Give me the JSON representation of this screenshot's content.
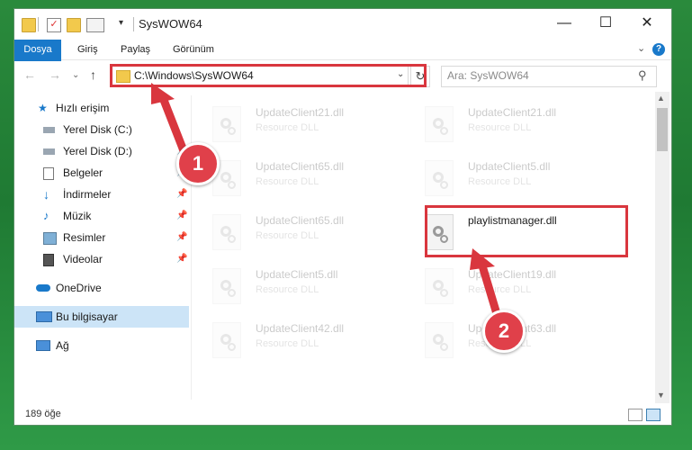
{
  "window": {
    "title": "SysWOW64",
    "controls": {
      "minimize": "—",
      "maximize": "☐",
      "close": "✕"
    }
  },
  "ribbon": {
    "tabs": [
      "Dosya",
      "Giriş",
      "Paylaş",
      "Görünüm"
    ],
    "help": "?"
  },
  "nav": {
    "address": "C:\\Windows\\SysWOW64",
    "search_placeholder": "Ara: SysWOW64"
  },
  "sidebar": {
    "items": [
      {
        "label": "Hızlı erişim",
        "icon": "star-icon",
        "pinned": false
      },
      {
        "label": "Yerel Disk (C:)",
        "icon": "drive-icon",
        "pinned": false
      },
      {
        "label": "Yerel Disk (D:)",
        "icon": "drive-icon",
        "pinned": true
      },
      {
        "label": "Belgeler",
        "icon": "documents-icon",
        "pinned": true
      },
      {
        "label": "İndirmeler",
        "icon": "downloads-icon",
        "pinned": true
      },
      {
        "label": "Müzik",
        "icon": "music-icon",
        "pinned": true
      },
      {
        "label": "Resimler",
        "icon": "pictures-icon",
        "pinned": true
      },
      {
        "label": "Videolar",
        "icon": "videos-icon",
        "pinned": true
      },
      {
        "label": "OneDrive",
        "icon": "cloud-icon",
        "pinned": false
      },
      {
        "label": "Bu bilgisayar",
        "icon": "computer-icon",
        "pinned": false,
        "selected": true
      },
      {
        "label": "Ağ",
        "icon": "network-icon",
        "pinned": false
      }
    ]
  },
  "files": [
    {
      "name": "UpdateClient21.dll",
      "type": "Resource DLL"
    },
    {
      "name": "UpdateClient21.dll",
      "type": "Resource DLL"
    },
    {
      "name": "UpdateClient65.dll",
      "type": "Resource DLL"
    },
    {
      "name": "UpdateClient5.dll",
      "type": "Resource DLL"
    },
    {
      "name": "UpdateClient65.dll",
      "type": "Resource DLL"
    },
    {
      "name": "playlistmanager.dll",
      "type": ""
    },
    {
      "name": "UpdateClient5.dll",
      "type": "Resource DLL"
    },
    {
      "name": "UpdateClient19.dll",
      "type": "Resource DLL"
    },
    {
      "name": "UpdateClient42.dll",
      "type": "Resource DLL"
    },
    {
      "name": "UpdateClient63.dll",
      "type": "Resource DLL"
    }
  ],
  "status": {
    "count": "189 öğe"
  },
  "callouts": [
    "1",
    "2"
  ],
  "colors": {
    "accent": "#1979ca",
    "highlight": "#d9363e",
    "selected": "#cce4f7"
  }
}
